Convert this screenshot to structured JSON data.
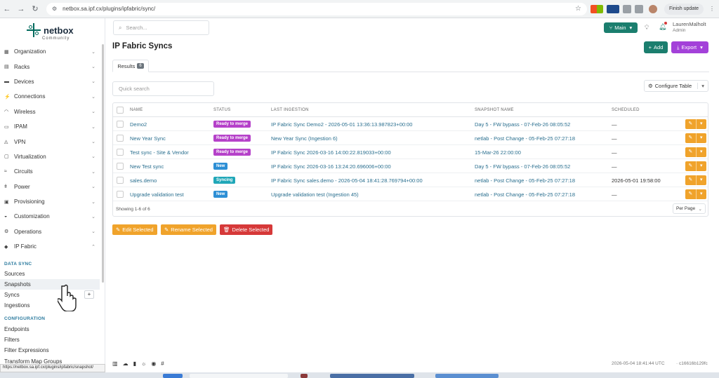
{
  "browser": {
    "url": "netbox.sa.ipf.cx/plugins/ipfabric/sync/",
    "finish_update": "Finish update"
  },
  "brand": {
    "name": "netbox",
    "sub": "Community"
  },
  "sidebar": {
    "items": [
      {
        "label": "Organization",
        "icon": "building-icon"
      },
      {
        "label": "Racks",
        "icon": "rack-icon"
      },
      {
        "label": "Devices",
        "icon": "server-icon"
      },
      {
        "label": "Connections",
        "icon": "plug-icon"
      },
      {
        "label": "Wireless",
        "icon": "wifi-icon"
      },
      {
        "label": "IPAM",
        "icon": "counter-icon"
      },
      {
        "label": "VPN",
        "icon": "vpn-icon"
      },
      {
        "label": "Virtualization",
        "icon": "monitor-icon"
      },
      {
        "label": "Circuits",
        "icon": "circuit-icon"
      },
      {
        "label": "Power",
        "icon": "power-icon"
      },
      {
        "label": "Provisioning",
        "icon": "provisioning-icon"
      },
      {
        "label": "Customization",
        "icon": "customization-icon"
      },
      {
        "label": "Operations",
        "icon": "cogs-icon"
      },
      {
        "label": "IP Fabric",
        "icon": "ipfabric-icon"
      }
    ],
    "data_sync_title": "DATA SYNC",
    "data_sync": [
      "Sources",
      "Snapshots",
      "Syncs",
      "Ingestions"
    ],
    "config_title": "CONFIGURATION",
    "config": [
      "Endpoints",
      "Filters",
      "Filter Expressions",
      "Transform Map Groups"
    ],
    "status_url": "https://netbox.sa.ipf.cx/plugins/ipfabric/snapshot/"
  },
  "topbar": {
    "search_placeholder": "Search...",
    "branch": "Main",
    "user_name": "LaurenMalholt",
    "user_role": "Admin"
  },
  "page": {
    "title": "IP Fabric Syncs",
    "add": "Add",
    "export": "Export",
    "tab_label": "Results",
    "tab_count": "6",
    "quick_search": "Quick search",
    "configure_table": "Configure Table"
  },
  "table": {
    "headers": [
      "NAME",
      "STATUS",
      "LAST INGESTION",
      "SNAPSHOT NAME",
      "SCHEDULED"
    ],
    "rows": [
      {
        "name": "Demo2",
        "status": "Ready to merge",
        "status_color": "#b541c9",
        "ingestion": "IP Fabric Sync Demo2 - 2026-05-01 13:36:13.987823+00:00",
        "snapshot": "Day 5 - FW bypass - 07-Feb-26 08:05:52",
        "scheduled": "—"
      },
      {
        "name": "New Year Sync",
        "status": "Ready to merge",
        "status_color": "#b541c9",
        "ingestion": "New Year Sync (Ingestion 6)",
        "snapshot": "netlab - Post Change - 05-Feb-25 07:27:18",
        "scheduled": "—"
      },
      {
        "name": "Test sync - Site & Vendor",
        "status": "Ready to merge",
        "status_color": "#b541c9",
        "ingestion": "IP Fabric Sync 2026-03-16 14:00:22.819033+00:00",
        "snapshot": "15-Mar-26 22:00:00",
        "scheduled": "—"
      },
      {
        "name": "New Test sync",
        "status": "New",
        "status_color": "#2d8fd5",
        "ingestion": "IP Fabric Sync 2026-03-16 13:24:20.696006+00:00",
        "snapshot": "Day 5 - FW bypass - 07-Feb-26 08:05:52",
        "scheduled": "—"
      },
      {
        "name": "sales.demo",
        "status": "Syncing",
        "status_color": "#20a7b8",
        "ingestion": "IP Fabric Sync sales.demo - 2026-05-04 18:41:28.769794+00:00",
        "snapshot": "netlab - Post Change - 05-Feb-25 07:27:18",
        "scheduled": "2026-05-01 19:58:00"
      },
      {
        "name": "Upgrade validation test",
        "status": "New",
        "status_color": "#2d8fd5",
        "ingestion": "Upgrade validation test (Ingestion 45)",
        "snapshot": "netlab - Post Change - 05-Feb-25 07:27:18",
        "scheduled": "—"
      }
    ],
    "showing": "Showing 1-6 of 6",
    "per_page": "Per Page"
  },
  "bulk": {
    "edit": "Edit Selected",
    "rename": "Rename Selected",
    "delete": "Delete Selected"
  },
  "footer": {
    "time": "2026-05-04 18:41:44 UTC",
    "commit": "· c16616b129fc"
  },
  "colors": {
    "primary": "#1b7e6e",
    "export": "#a341d9",
    "warning": "#f0a32b",
    "danger": "#d63939",
    "link": "#2a6f8f"
  }
}
